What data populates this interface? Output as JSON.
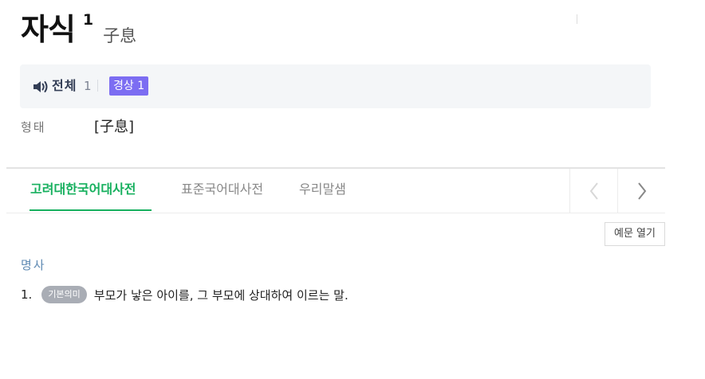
{
  "entry": {
    "headword": "자식",
    "homonym_number": "1",
    "hanja": "子息"
  },
  "pronunciation": {
    "speaker_icon": "speaker-icon",
    "all_label": "전체",
    "all_count": "1",
    "dialect_chip": "경상 1"
  },
  "form": {
    "label": "형태",
    "value": "[子息]"
  },
  "tabs": [
    {
      "label": "고려대한국어대사전",
      "active": true
    },
    {
      "label": "표준국어대사전",
      "active": false
    },
    {
      "label": "우리말샘",
      "active": false
    }
  ],
  "tab_nav": {
    "prev_icon": "chevron-left-icon",
    "next_icon": "chevron-right-icon"
  },
  "example_toggle_label": "예문 열기",
  "sense": {
    "pos": "명사",
    "number": "1.",
    "badge": "기본의미",
    "definition": "부모가 낳은 아이를, 그 부모에 상대하여 이르는 말."
  },
  "colors": {
    "accent_green": "#16b05e",
    "dialect_chip": "#7c6df2",
    "pos_blue": "#5f8ab3",
    "badge_gray": "#a9adb5"
  }
}
